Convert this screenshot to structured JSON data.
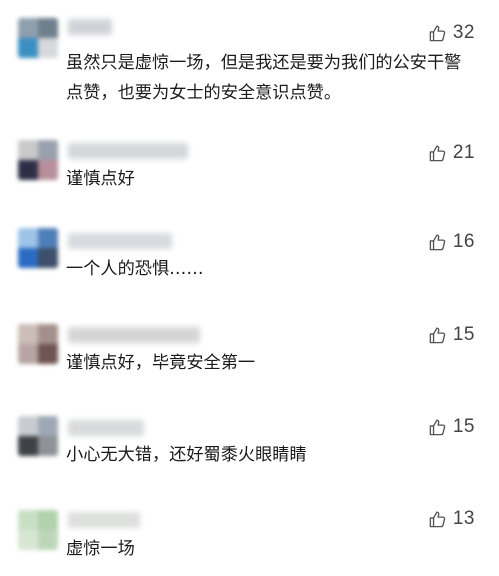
{
  "comments": [
    {
      "likes": "32",
      "text": "虽然只是虚惊一场，但是我还是要为我们的公安干警点赞，也要为女士的安全意识点赞。",
      "avatar_colors": [
        "#8e9fae",
        "#6f7f8c",
        "#3c8fc2",
        "#d7d9dc"
      ],
      "name_color": "#cfd3d7"
    },
    {
      "likes": "21",
      "text": "谨慎点好",
      "avatar_colors": [
        "#c9c9cc",
        "#9aa0ad",
        "#2e2f47",
        "#b88f9a"
      ],
      "name_color": "#d4d6d9"
    },
    {
      "likes": "16",
      "text": "一个人的恐惧……",
      "avatar_colors": [
        "#9dc3e6",
        "#4f7fb9",
        "#2c6bc3",
        "#3d4f6b"
      ],
      "name_color": "#d7dadf"
    },
    {
      "likes": "15",
      "text": "谨慎点好，毕竟安全第一",
      "avatar_colors": [
        "#cbbdb8",
        "#a58f8a",
        "#b7a5a3",
        "#6e5452"
      ],
      "name_color": "#d5d5d5"
    },
    {
      "likes": "15",
      "text": "小心无大错，还好蜀黍火眼睛睛",
      "avatar_colors": [
        "#c8ccd2",
        "#9ea8b4",
        "#3f4146",
        "#8f9297"
      ],
      "name_color": "#d8dadc"
    },
    {
      "likes": "13",
      "text": "虚惊一场",
      "avatar_colors": [
        "#c9dfc5",
        "#b2d1ad",
        "#d7e6d3",
        "#bcd7b8"
      ],
      "name_color": "#dcdfdc"
    }
  ]
}
